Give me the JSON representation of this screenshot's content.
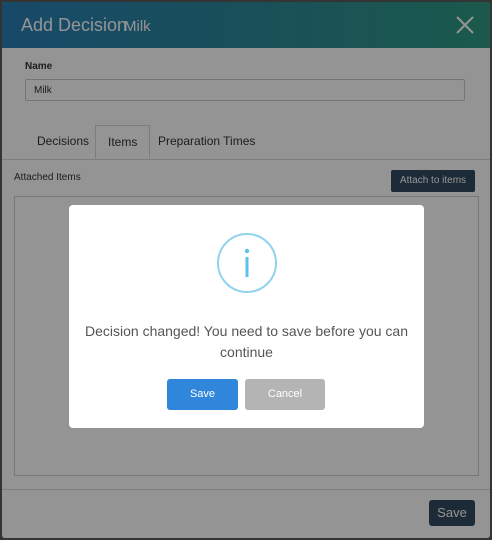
{
  "dialog": {
    "title": "Add Decision",
    "subtitle": "Milk",
    "close_icon": "close-icon"
  },
  "form": {
    "name_label": "Name",
    "name_value": "Milk"
  },
  "tabs": [
    {
      "label": "Decisions",
      "active": false
    },
    {
      "label": "Items",
      "active": true
    },
    {
      "label": "Preparation Times",
      "active": false
    }
  ],
  "items_section": {
    "label": "Attached Items",
    "attach_button": "Attach to items"
  },
  "footer": {
    "save_label": "Save"
  },
  "modal": {
    "icon": "info-icon",
    "message": "Decision changed! You need to save before you can continue",
    "save_label": "Save",
    "cancel_label": "Cancel"
  },
  "colors": {
    "title_gradient_start": "#2a7fb6",
    "title_gradient_end": "#2f9a84",
    "primary_dark": "#32495f",
    "modal_save": "#2f86da",
    "modal_cancel": "#b4b4b4",
    "info_icon": "#8fd3ef"
  }
}
